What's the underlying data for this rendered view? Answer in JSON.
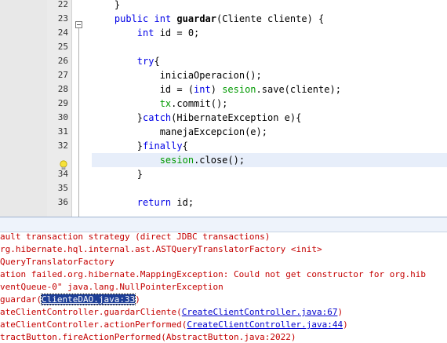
{
  "editor": {
    "lines": [
      {
        "num": "22",
        "tokens": [
          {
            "t": "    }",
            "c": "plain"
          }
        ]
      },
      {
        "num": "23",
        "tokens": [
          {
            "t": "    ",
            "c": "plain"
          },
          {
            "t": "public",
            "c": "kw"
          },
          {
            "t": " ",
            "c": "plain"
          },
          {
            "t": "int",
            "c": "kw"
          },
          {
            "t": " ",
            "c": "plain"
          },
          {
            "t": "guardar",
            "c": "bold"
          },
          {
            "t": "(Cliente cliente) {",
            "c": "plain"
          }
        ]
      },
      {
        "num": "24",
        "tokens": [
          {
            "t": "        ",
            "c": "plain"
          },
          {
            "t": "int",
            "c": "kw"
          },
          {
            "t": " id = 0;",
            "c": "plain"
          }
        ]
      },
      {
        "num": "25",
        "tokens": []
      },
      {
        "num": "26",
        "tokens": [
          {
            "t": "        ",
            "c": "plain"
          },
          {
            "t": "try",
            "c": "kw"
          },
          {
            "t": "{",
            "c": "plain"
          }
        ]
      },
      {
        "num": "27",
        "tokens": [
          {
            "t": "            iniciaOperacion();",
            "c": "plain"
          }
        ]
      },
      {
        "num": "28",
        "tokens": [
          {
            "t": "            id = (",
            "c": "plain"
          },
          {
            "t": "int",
            "c": "kw"
          },
          {
            "t": ") ",
            "c": "plain"
          },
          {
            "t": "sesion",
            "c": "field"
          },
          {
            "t": ".save(cliente);",
            "c": "plain"
          }
        ]
      },
      {
        "num": "29",
        "tokens": [
          {
            "t": "            ",
            "c": "plain"
          },
          {
            "t": "tx",
            "c": "field"
          },
          {
            "t": ".commit();",
            "c": "plain"
          }
        ]
      },
      {
        "num": "30",
        "tokens": [
          {
            "t": "        }",
            "c": "plain"
          },
          {
            "t": "catch",
            "c": "kw"
          },
          {
            "t": "(HibernateException e){",
            "c": "plain"
          }
        ]
      },
      {
        "num": "31",
        "tokens": [
          {
            "t": "            manejaExcepcion(e);",
            "c": "plain"
          }
        ]
      },
      {
        "num": "32",
        "tokens": [
          {
            "t": "        }",
            "c": "plain"
          },
          {
            "t": "finally",
            "c": "kw"
          },
          {
            "t": "{",
            "c": "plain"
          }
        ]
      },
      {
        "num": "",
        "tokens": [
          {
            "t": "            ",
            "c": "plain"
          },
          {
            "t": "sesion",
            "c": "field"
          },
          {
            "t": ".close();",
            "c": "plain"
          }
        ],
        "current": true,
        "hint": "lightbulb-icon"
      },
      {
        "num": "34",
        "tokens": [
          {
            "t": "        }",
            "c": "plain"
          }
        ]
      },
      {
        "num": "35",
        "tokens": []
      },
      {
        "num": "36",
        "tokens": [
          {
            "t": "        ",
            "c": "plain"
          },
          {
            "t": "return",
            "c": "kw"
          },
          {
            "t": " id;",
            "c": "plain"
          }
        ]
      }
    ]
  },
  "output": {
    "lines": [
      {
        "text": "ault transaction strategy (direct JDBC transactions)"
      },
      {
        "text": "rg.hibernate.hql.internal.ast.ASTQueryTranslatorFactory <init>"
      },
      {
        "text": "QueryTranslatorFactory"
      },
      {
        "text": "ation failed.org.hibernate.MappingException: Could not get constructor for org.hib"
      },
      {
        "text": "ventQueue-0\" java.lang.NullPointerException"
      },
      {
        "text": "guardar(",
        "link": "ClienteDAO.java:33",
        "after": ")",
        "selected": true
      },
      {
        "text": "ateClientController.guardarCliente(",
        "link": "CreateClientController.java:67",
        "after": ")"
      },
      {
        "text": "ateClientController.actionPerformed(",
        "link": "CreateClientController.java:44",
        "after": ")"
      },
      {
        "text": "tractButton.fireActionPerformed(AbstractButton.java:2022)"
      }
    ]
  },
  "colors": {
    "keyword": "#0000e6",
    "field": "#009900",
    "error_text": "#c40000",
    "link": "#0000cc",
    "current_line": "#e7eefa"
  }
}
